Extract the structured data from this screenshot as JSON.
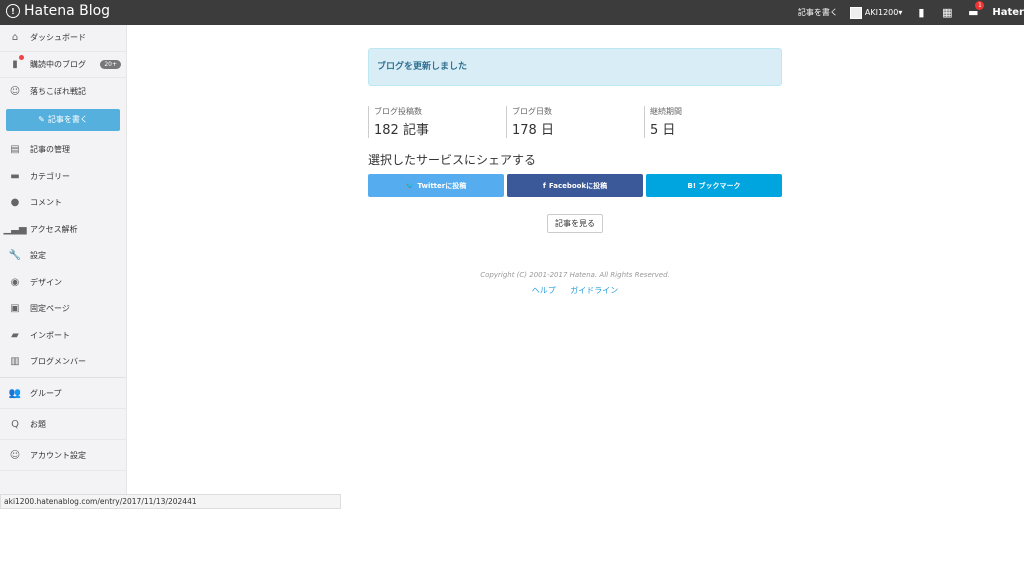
{
  "header": {
    "logo": "Hatena Blog",
    "write_link": "記事を書く",
    "username": "AKI1200",
    "user_caret": "▾",
    "notification_count": "1",
    "brand": "Hater"
  },
  "sidebar": {
    "items": [
      {
        "label": "ダッシュボード",
        "icon": "home-icon"
      },
      {
        "label": "購読中のブログ",
        "icon": "bookmark-icon",
        "badge": "20+"
      },
      {
        "label": "落ちこぼれ戦記",
        "icon": "blog-icon"
      }
    ],
    "write_button": "記事を書く",
    "menu": [
      {
        "label": "記事の管理",
        "icon": "document-icon"
      },
      {
        "label": "カテゴリー",
        "icon": "folder-icon"
      },
      {
        "label": "コメント",
        "icon": "comment-icon"
      },
      {
        "label": "アクセス解析",
        "icon": "bar-chart-icon"
      },
      {
        "label": "設定",
        "icon": "wrench-icon"
      },
      {
        "label": "デザイン",
        "icon": "palette-icon"
      },
      {
        "label": "固定ページ",
        "icon": "page-icon"
      },
      {
        "label": "インポート",
        "icon": "truck-icon"
      },
      {
        "label": "ブログメンバー",
        "icon": "members-icon"
      }
    ],
    "bottom": [
      {
        "label": "グループ",
        "icon": "group-icon"
      },
      {
        "label": "お題",
        "icon": "question-icon"
      },
      {
        "label": "アカウント設定",
        "icon": "account-icon"
      }
    ]
  },
  "main": {
    "alert": "ブログを更新しました",
    "stats": [
      {
        "label": "ブログ投稿数",
        "value": "182 記事"
      },
      {
        "label": "ブログ日数",
        "value": "178 日"
      },
      {
        "label": "継続期間",
        "value": "5 日"
      }
    ],
    "share_title": "選択したサービスにシェアする",
    "share_buttons": {
      "twitter": "Twitterに投稿",
      "facebook": "Facebookに投稿",
      "bookmark": "B! ブックマーク"
    },
    "view_button": "記事を見る",
    "copyright": "Copyright (C) 2001-2017 Hatena. All Rights Reserved.",
    "footer_links": [
      "ヘルプ",
      "ガイドライン"
    ]
  },
  "statusbar": {
    "url": "aki1200.hatenablog.com/entry/2017/11/13/202441"
  }
}
